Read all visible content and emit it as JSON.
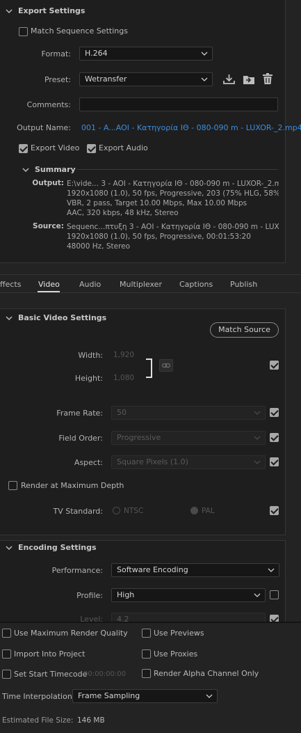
{
  "export_settings": {
    "header": "Export Settings",
    "match_sequence_label": "Match Sequence Settings",
    "format_label": "Format:",
    "format_value": "H.264",
    "preset_label": "Preset:",
    "preset_value": "Wetransfer",
    "comments_label": "Comments:",
    "comments_value": "",
    "output_name_label": "Output Name:",
    "output_name_value": "001 - A...AOI - Κατηγορία ΙΘ - 080-090 m - LUXOR-_2.mp4",
    "export_video_label": "Export Video",
    "export_audio_label": "Export Audio",
    "export_video_checked": true,
    "export_audio_checked": true,
    "match_sequence_checked": false,
    "summary": {
      "header": "Summary",
      "output_key": "Output:",
      "output_lines": [
        "E:\\vide... 3 - AOI - Κατηγορία ΙΘ - 080-090 m - LUXOR-_2.mp4",
        "1920x1080 (1.0), 50 fps, Progressive, 203 (75% HLG, 58% P...",
        "VBR, 2 pass, Target 10.00 Mbps, Max 10.00 Mbps",
        "AAC, 320 kbps, 48 kHz, Stereo"
      ],
      "source_key": "Source:",
      "source_lines": [
        "Sequenc...πτυξη 3 - AOI - Κατηγορία ΙΘ - 080-090 m - LUXOR",
        "1920x1080 (1.0), 50 fps, Progressive, 00:01:53:20",
        "48000 Hz, Stereo"
      ]
    }
  },
  "tabs": [
    {
      "label": "ffects",
      "active": false
    },
    {
      "label": "Video",
      "active": true
    },
    {
      "label": "Audio",
      "active": false
    },
    {
      "label": "Multiplexer",
      "active": false
    },
    {
      "label": "Captions",
      "active": false
    },
    {
      "label": "Publish",
      "active": false
    }
  ],
  "basic_video": {
    "header": "Basic Video Settings",
    "match_source_label": "Match Source",
    "width_label": "Width:",
    "width_value": "1,920",
    "height_label": "Height:",
    "height_value": "1,080",
    "frame_rate_label": "Frame Rate:",
    "frame_rate_value": "50",
    "field_order_label": "Field Order:",
    "field_order_value": "Progressive",
    "aspect_label": "Aspect:",
    "aspect_value": "Square Pixels (1.0)",
    "render_max_depth_label": "Render at Maximum Depth",
    "tv_standard_label": "TV Standard:",
    "ntsc_label": "NTSC",
    "pal_label": "PAL"
  },
  "encoding": {
    "header": "Encoding Settings",
    "performance_label": "Performance:",
    "performance_value": "Software Encoding",
    "profile_label": "Profile:",
    "profile_value": "High",
    "level_label": "Level:",
    "level_value": "4.2"
  },
  "bottom": {
    "max_render_quality_label": "Use Maximum Render Quality",
    "use_previews_label": "Use Previews",
    "import_project_label": "Import Into Project",
    "use_proxies_label": "Use Proxies",
    "set_start_timecode_label": "Set Start Timecode",
    "start_timecode_value": "00:00:00:00",
    "render_alpha_label": "Render Alpha Channel Only",
    "time_interp_label": "Time Interpolation:",
    "time_interp_value": "Frame Sampling",
    "est_size_label": "Estimated File Size:",
    "est_size_value": "146 MB"
  },
  "colors": {
    "accent_link": "#3b8de0",
    "background": "#232323",
    "panel": "#1e1e1e"
  }
}
